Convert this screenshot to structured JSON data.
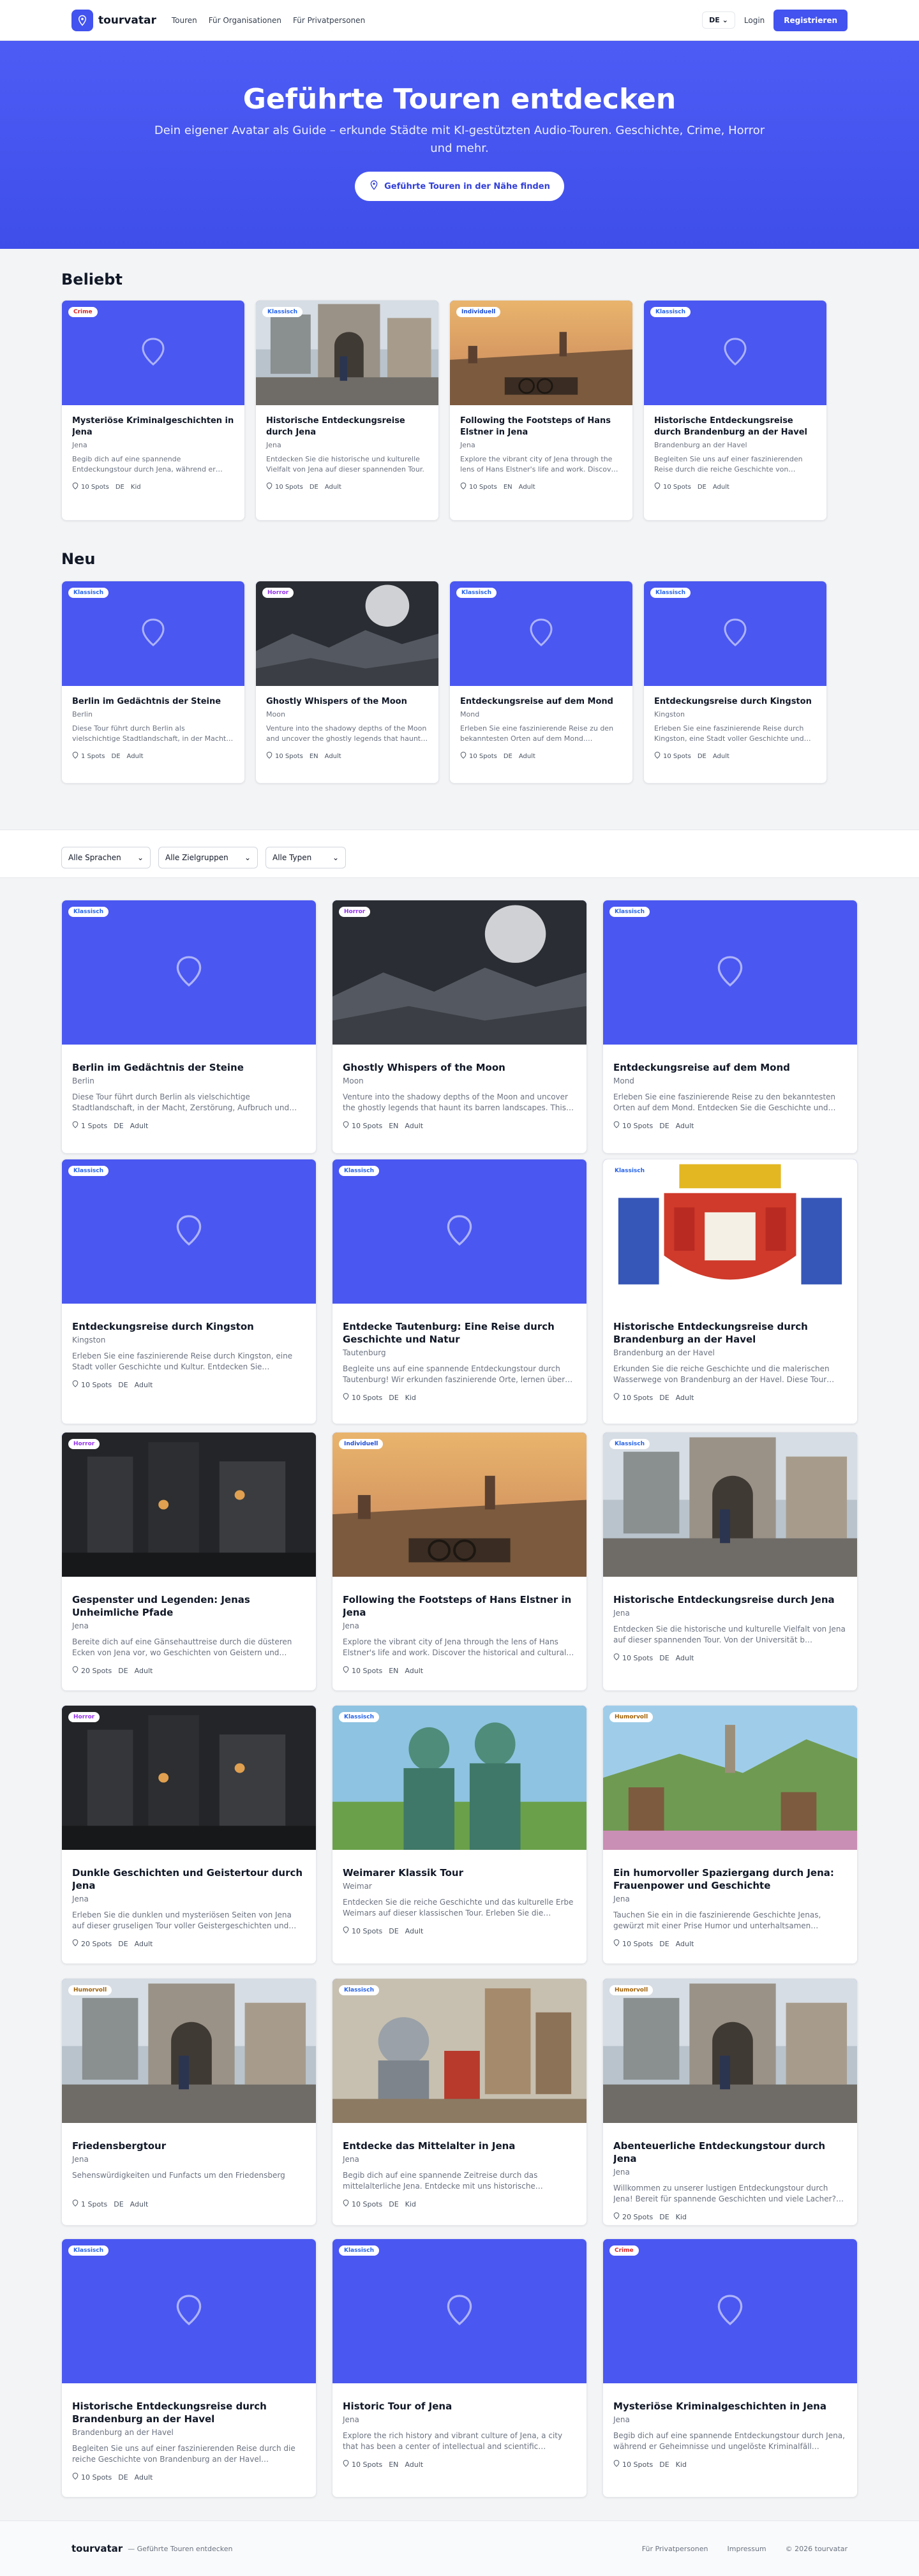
{
  "colors": {
    "brand": "#4353ef",
    "accent_text": "#3340d8",
    "placeholder_thumb": "#4a57f1"
  },
  "nav": {
    "logo_text": "tourvatar",
    "links": [
      "Touren",
      "Für Organisationen",
      "Für Privatpersonen"
    ],
    "language": "DE",
    "login": "Login",
    "register": "Registrieren"
  },
  "hero": {
    "title": "Geführte Touren entdecken",
    "subtitle": "Dein eigener Avatar als Guide – erkunde Städte mit KI-gestützten Audio-Touren. Geschichte, Crime, Horror und mehr.",
    "button": "Geführte Touren in der Nähe finden"
  },
  "sections": {
    "popular": "Beliebt",
    "new": "Neu"
  },
  "filters": {
    "language": "Alle Sprachen",
    "audience": "Alle Zielgruppen",
    "type": "Alle Typen"
  },
  "badge_colors": {
    "Klassisch": "#2563eb",
    "Crime": "#dc2626",
    "Horror": "#9333ea",
    "Individuell": "#1d4ed8",
    "Humorvoll": "#a16207"
  },
  "popular": [
    {
      "badge": "Crime",
      "title": "Mysteriöse Kriminalgeschichten in Jena",
      "city": "Jena",
      "desc": "Begib dich auf eine spannende Entdeckungstour durch Jena, während er Geheimnisse und ungelöste Kriminalfälle…",
      "spots": "10 Spots",
      "lang": "DE",
      "audience": "Kid",
      "image": "placeholder"
    },
    {
      "badge": "Klassisch",
      "title": "Historische Entdeckungsreise durch Jena",
      "city": "Jena",
      "desc": "Entdecken Sie die historische und kulturelle Vielfalt von Jena auf dieser spannenden Tour.",
      "spots": "10 Spots",
      "lang": "DE",
      "audience": "Adult",
      "image": "street"
    },
    {
      "badge": "Individuell",
      "title": "Following the Footsteps of Hans Elstner in Jena",
      "city": "Jena",
      "desc": "Explore the vibrant city of Jena through the lens of Hans Elstner's life and work. Discover the historical and cultural…",
      "spots": "10 Spots",
      "lang": "EN",
      "audience": "Adult",
      "image": "city"
    },
    {
      "badge": "Klassisch",
      "title": "Historische Entdeckungsreise durch Brandenburg an der Havel",
      "city": "Brandenburg an der Havel",
      "desc": "Begleiten Sie uns auf einer faszinierenden Reise durch die reiche Geschichte von Brandenburg an der Havel.",
      "spots": "10 Spots",
      "lang": "DE",
      "audience": "Adult",
      "image": "placeholder"
    }
  ],
  "newest": [
    {
      "badge": "Klassisch",
      "title": "Berlin im Gedächtnis der Steine",
      "city": "Berlin",
      "desc": "Diese Tour führt durch Berlin als vielschichtige Stadtlandschaft, in der Macht, Zerstörung, Aufbruch und…",
      "spots": "1 Spots",
      "lang": "DE",
      "audience": "Adult",
      "image": "placeholder"
    },
    {
      "badge": "Horror",
      "title": "Ghostly Whispers of the Moon",
      "city": "Moon",
      "desc": "Venture into the shadowy depths of the Moon and uncover the ghostly legends that haunt its barren landscapes.",
      "spots": "10 Spots",
      "lang": "EN",
      "audience": "Adult",
      "image": "moon"
    },
    {
      "badge": "Klassisch",
      "title": "Entdeckungsreise auf dem Mond",
      "city": "Mond",
      "desc": "Erleben Sie eine faszinierende Reise zu den bekanntesten Orten auf dem Mond. Entdecken Sie die Geschichte und…",
      "spots": "10 Spots",
      "lang": "DE",
      "audience": "Adult",
      "image": "placeholder"
    },
    {
      "badge": "Klassisch",
      "title": "Entdeckungsreise durch Kingston",
      "city": "Kingston",
      "desc": "Erleben Sie eine faszinierende Reise durch Kingston, eine Stadt voller Geschichte und Kultur.",
      "spots": "10 Spots",
      "lang": "DE",
      "audience": "Adult",
      "image": "placeholder"
    }
  ],
  "all": [
    {
      "badge": "Klassisch",
      "title": "Berlin im Gedächtnis der Steine",
      "city": "Berlin",
      "desc": "Diese Tour führt durch Berlin als vielschichtige Stadtlandschaft, in der Macht, Zerstörung, Aufbruch und Erinnerung sichtbar werden.",
      "spots": "1 Spots",
      "lang": "DE",
      "audience": "Adult",
      "image": "placeholder"
    },
    {
      "badge": "Horror",
      "title": "Ghostly Whispers of the Moon",
      "city": "Moon",
      "desc": "Venture into the shadowy depths of the Moon and uncover the ghostly legends that haunt its barren landscapes. This tour…",
      "spots": "10 Spots",
      "lang": "EN",
      "audience": "Adult",
      "image": "moon"
    },
    {
      "badge": "Klassisch",
      "title": "Entdeckungsreise auf dem Mond",
      "city": "Mond",
      "desc": "Erleben Sie eine faszinierende Reise zu den bekanntesten Orten auf dem Mond. Entdecken Sie die Geschichte und Geheimnisse…",
      "spots": "10 Spots",
      "lang": "DE",
      "audience": "Adult",
      "image": "placeholder"
    },
    {
      "badge": "Klassisch",
      "title": "Entdeckungsreise durch Kingston",
      "city": "Kingston",
      "desc": "Erleben Sie eine faszinierende Reise durch Kingston, eine Stadt voller Geschichte und Kultur. Entdecken Sie…",
      "spots": "10 Spots",
      "lang": "DE",
      "audience": "Adult",
      "image": "placeholder"
    },
    {
      "badge": "Klassisch",
      "title": "Entdecke Tautenburg: Eine Reise durch Geschichte und Natur",
      "city": "Tautenburg",
      "desc": "Begleite uns auf eine spannende Entdeckungstour durch Tautenburg! Wir erkunden faszinierende Orte, lernen über…",
      "spots": "10 Spots",
      "lang": "DE",
      "audience": "Kid",
      "image": "placeholder"
    },
    {
      "badge": "Klassisch",
      "title": "Historische Entdeckungsreise durch Brandenburg an der Havel",
      "city": "Brandenburg an der Havel",
      "desc": "Erkunden Sie die reiche Geschichte und die malerischen Wasserwege von Brandenburg an der Havel. Diese Tour…",
      "spots": "10 Spots",
      "lang": "DE",
      "audience": "Adult",
      "image": "crest"
    },
    {
      "badge": "Horror",
      "title": "Gespenster und Legenden: Jenas Unheimliche Pfade",
      "city": "Jena",
      "desc": "Bereite dich auf eine Gänsehauttreise durch die düsteren Ecken von Jena vor, wo Geschichten von Geistern und…",
      "spots": "20 Spots",
      "lang": "DE",
      "audience": "Adult",
      "image": "dark"
    },
    {
      "badge": "Individuell",
      "title": "Following the Footsteps of Hans Elstner in Jena",
      "city": "Jena",
      "desc": "Explore the vibrant city of Jena through the lens of Hans Elstner's life and work. Discover the historical and cultural…",
      "spots": "10 Spots",
      "lang": "EN",
      "audience": "Adult",
      "image": "city"
    },
    {
      "badge": "Klassisch",
      "title": "Historische Entdeckungsreise durch Jena",
      "city": "Jena",
      "desc": "Entdecken Sie die historische und kulturelle Vielfalt von Jena auf dieser spannenden Tour. Von der Universität b…",
      "spots": "10 Spots",
      "lang": "DE",
      "audience": "Adult",
      "image": "street"
    },
    {
      "badge": "Horror",
      "title": "Dunkle Geschichten und Geistertour durch Jena",
      "city": "Jena",
      "desc": "Erleben Sie die dunklen und mysteriösen Seiten von Jena auf dieser gruseligen Tour voller Geistergeschichten und…",
      "spots": "20 Spots",
      "lang": "DE",
      "audience": "Adult",
      "image": "dark"
    },
    {
      "badge": "Klassisch",
      "title": "Weimarer Klassik Tour",
      "city": "Weimar",
      "desc": "Entdecken Sie die reiche Geschichte und das kulturelle Erbe Weimars auf dieser klassischen Tour. Erleben Sie die…",
      "spots": "10 Spots",
      "lang": "DE",
      "audience": "Adult",
      "image": "statue"
    },
    {
      "badge": "Humorvoll",
      "title": "Ein humorvoller Spaziergang durch Jena: Frauenpower und Geschichte",
      "city": "Jena",
      "desc": "Tauchen Sie ein in die faszinierende Geschichte Jenas, gewürzt mit einer Prise Humor und unterhaltsamen…",
      "spots": "10 Spots",
      "lang": "DE",
      "audience": "Adult",
      "image": "landscape"
    },
    {
      "badge": "Humorvoll",
      "title": "Friedensbergtour",
      "city": "Jena",
      "desc": "Sehenswürdigkeiten und Funfacts um den Friedensberg",
      "spots": "1 Spots",
      "lang": "DE",
      "audience": "Adult",
      "image": "street"
    },
    {
      "badge": "Klassisch",
      "title": "Entdecke das Mittelalter in Jena",
      "city": "Jena",
      "desc": "Begib dich auf eine spannende Zeitreise durch das mittelalterliche Jena. Entdecke mit uns historische…",
      "spots": "10 Spots",
      "lang": "DE",
      "audience": "Kid",
      "image": "medieval"
    },
    {
      "badge": "Humorvoll",
      "title": "Abenteuerliche Entdeckungstour durch Jena",
      "city": "Jena",
      "desc": "Willkommen zu unserer lustigen Entdeckungstour durch Jena! Bereit für spannende Geschichten und viele Lacher?…",
      "spots": "20 Spots",
      "lang": "DE",
      "audience": "Kid",
      "image": "street"
    },
    {
      "badge": "Klassisch",
      "title": "Historische Entdeckungsreise durch Brandenburg an der Havel",
      "city": "Brandenburg an der Havel",
      "desc": "Begleiten Sie uns auf einer faszinierenden Reise durch die reiche Geschichte von Brandenburg an der Havel…",
      "spots": "10 Spots",
      "lang": "DE",
      "audience": "Adult",
      "image": "placeholder"
    },
    {
      "badge": "Klassisch",
      "title": "Historic Tour of Jena",
      "city": "Jena",
      "desc": "Explore the rich history and vibrant culture of Jena, a city that has been a center of intellectual and scientific…",
      "spots": "10 Spots",
      "lang": "EN",
      "audience": "Adult",
      "image": "placeholder"
    },
    {
      "badge": "Crime",
      "title": "Mysteriöse Kriminalgeschichten in Jena",
      "city": "Jena",
      "desc": "Begib dich auf eine spannende Entdeckungstour durch Jena, während er Geheimnisse und ungelöste Kriminalfäll…",
      "spots": "10 Spots",
      "lang": "DE",
      "audience": "Kid",
      "image": "placeholder"
    }
  ],
  "footer": {
    "logo": "tourvatar",
    "tagline": "— Geführte Touren entdecken",
    "links": [
      "Für Privatpersonen",
      "Impressum",
      "© 2026 tourvatar"
    ]
  }
}
